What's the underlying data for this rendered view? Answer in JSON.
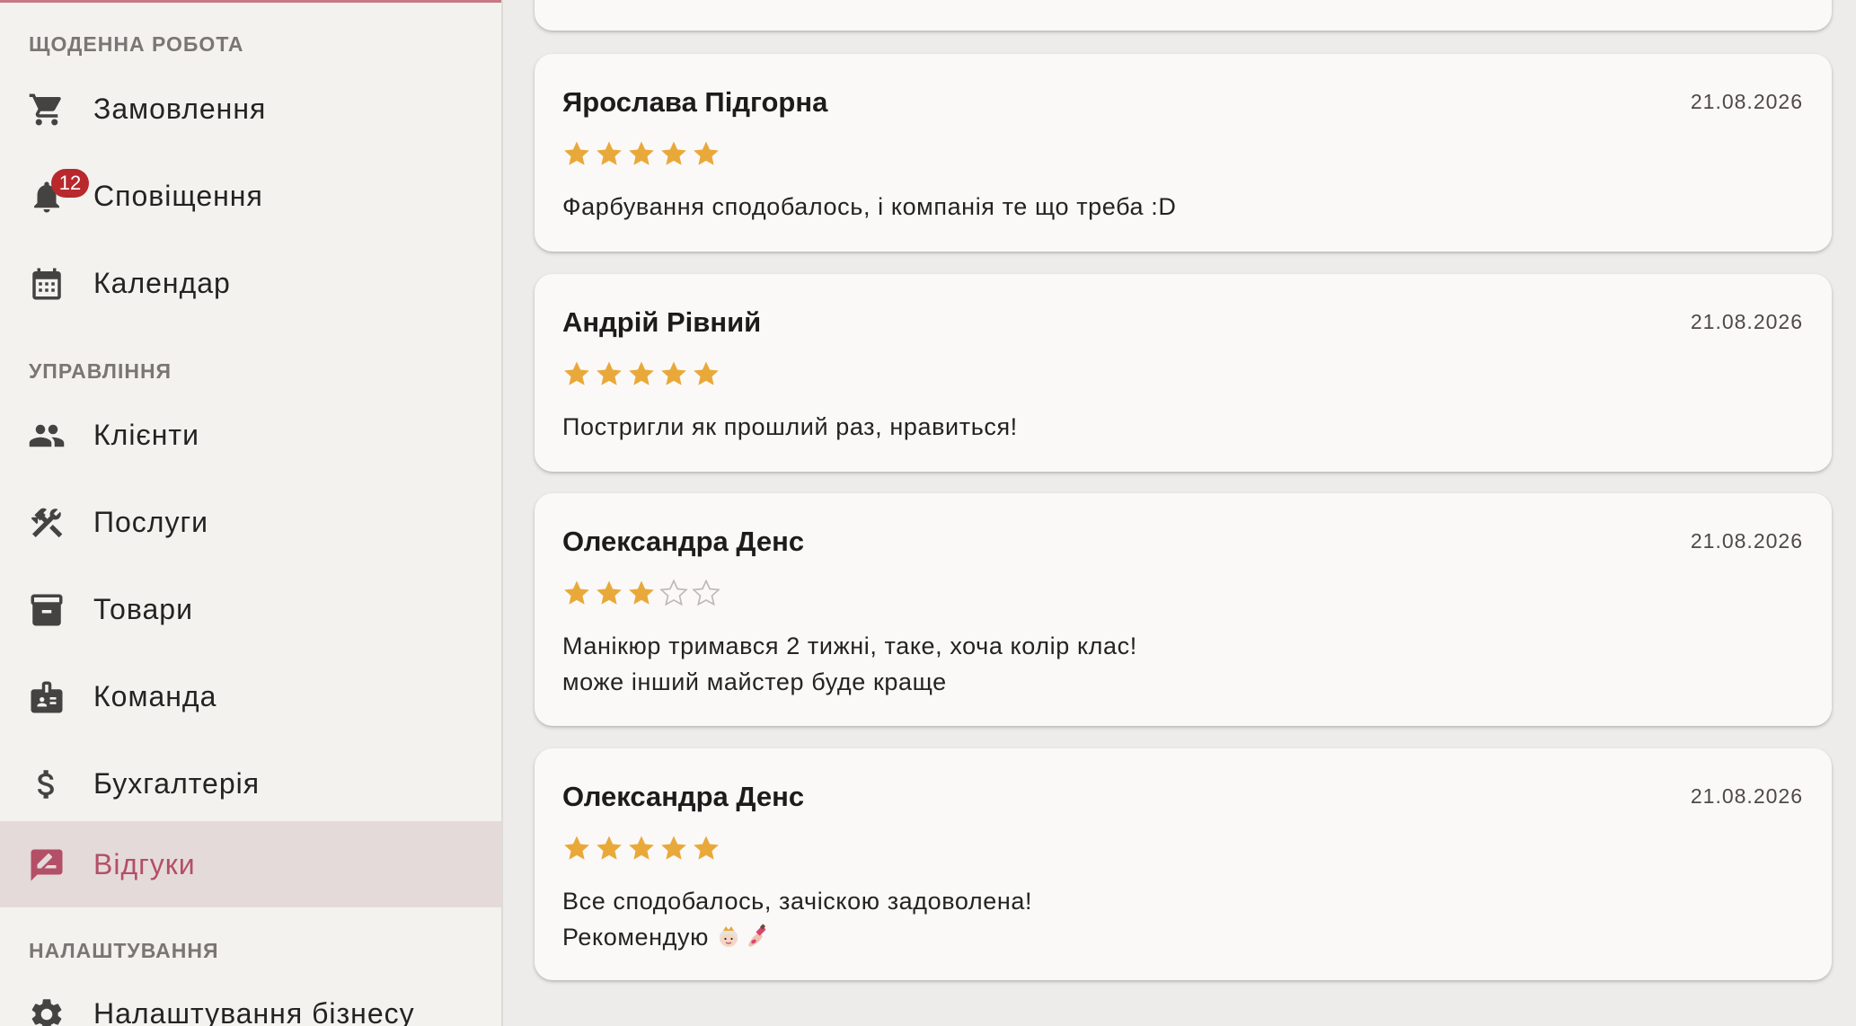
{
  "sidebar": {
    "sections": [
      {
        "label": "ЩОДЕННА РОБОТА"
      },
      {
        "label": "УПРАВЛІННЯ"
      },
      {
        "label": "НАЛАШТУВАННЯ"
      }
    ],
    "items": [
      {
        "label": "Замовлення",
        "icon": "cart-icon"
      },
      {
        "label": "Сповіщення",
        "icon": "bell-icon",
        "badge": "12"
      },
      {
        "label": "Календар",
        "icon": "calendar-icon"
      },
      {
        "label": "Клієнти",
        "icon": "people-icon"
      },
      {
        "label": "Послуги",
        "icon": "tools-icon"
      },
      {
        "label": "Товари",
        "icon": "archive-box-icon"
      },
      {
        "label": "Команда",
        "icon": "badge-id-icon"
      },
      {
        "label": "Бухгалтерія",
        "icon": "dollar-icon"
      },
      {
        "label": "Відгуки",
        "icon": "review-icon",
        "active": true
      },
      {
        "label": "Налаштування бізнесу",
        "icon": "gear-icon"
      }
    ]
  },
  "reviews": [
    {
      "name": "Ярослава Підгорна",
      "date": "21.08.2026",
      "rating": 5,
      "text": "Фарбування сподобалось, і компанія те що треба :D"
    },
    {
      "name": "Андрій Рівний",
      "date": "21.08.2026",
      "rating": 5,
      "text": "Постригли як прошлий раз, нравиться!"
    },
    {
      "name": "Олександра Денс",
      "date": "21.08.2026",
      "rating": 3,
      "text": "Манікюр тримався 2 тижні, таке, хоча колір клас!\nможе інший майстер буде краще"
    },
    {
      "name": "Олександра Денс",
      "date": "21.08.2026",
      "rating": 5,
      "text": "Все сподобалось, зачіскою задоволена!\nРекомендую",
      "emojis": [
        "princess-emoji",
        "nail-polish-emoji"
      ]
    }
  ],
  "colors": {
    "accent": "#b34f66",
    "star": "#e9a93a",
    "badge": "#b8282c",
    "active_bg": "#e5dada"
  }
}
